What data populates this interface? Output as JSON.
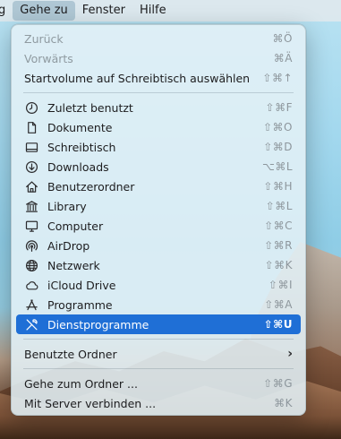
{
  "menubar": {
    "items": [
      {
        "label": "g"
      },
      {
        "label": "Gehe zu"
      },
      {
        "label": "Fenster"
      },
      {
        "label": "Hilfe"
      }
    ]
  },
  "menu": {
    "top": [
      {
        "label": "Zurück",
        "shortcut": "⌘Ö",
        "enabled": false
      },
      {
        "label": "Vorwärts",
        "shortcut": "⌘Ä",
        "enabled": false
      },
      {
        "label": "Startvolume auf Schreibtisch auswählen",
        "shortcut": "⇧⌘↑",
        "enabled": true
      }
    ],
    "places": [
      {
        "label": "Zuletzt benutzt",
        "shortcut": "⇧⌘F",
        "icon": "clock-icon"
      },
      {
        "label": "Dokumente",
        "shortcut": "⇧⌘O",
        "icon": "document-icon"
      },
      {
        "label": "Schreibtisch",
        "shortcut": "⇧⌘D",
        "icon": "desktop-icon"
      },
      {
        "label": "Downloads",
        "shortcut": "⌥⌘L",
        "icon": "download-icon"
      },
      {
        "label": "Benutzerordner",
        "shortcut": "⇧⌘H",
        "icon": "home-icon"
      },
      {
        "label": "Library",
        "shortcut": "⇧⌘L",
        "icon": "library-icon"
      },
      {
        "label": "Computer",
        "shortcut": "⇧⌘C",
        "icon": "computer-icon"
      },
      {
        "label": "AirDrop",
        "shortcut": "⇧⌘R",
        "icon": "airdrop-icon"
      },
      {
        "label": "Netzwerk",
        "shortcut": "⇧⌘K",
        "icon": "globe-icon"
      },
      {
        "label": "iCloud Drive",
        "shortcut": "⇧⌘I",
        "icon": "cloud-icon"
      },
      {
        "label": "Programme",
        "shortcut": "⇧⌘A",
        "icon": "applications-icon"
      },
      {
        "label": "Dienstprogramme",
        "shortcut": "⇧⌘U",
        "icon": "utilities-icon",
        "selected": true
      }
    ],
    "recent_folders": {
      "label": "Benutzte Ordner",
      "submenu_indicator": "›"
    },
    "bottom": [
      {
        "label": "Gehe zum Ordner ...",
        "shortcut": "⇧⌘G"
      },
      {
        "label": "Mit Server verbinden ...",
        "shortcut": "⌘K"
      }
    ]
  },
  "colors": {
    "selection": "#1f6fd6",
    "disabled_text": "#8f9aa0",
    "shortcut_text": "#8d969c"
  }
}
